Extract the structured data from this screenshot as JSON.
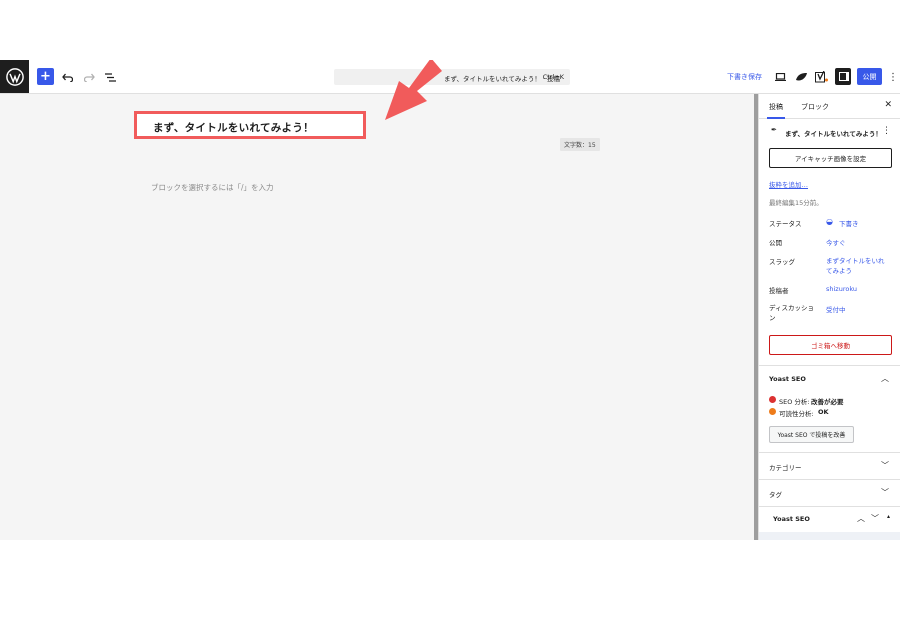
{
  "toolbar": {
    "command_title": "まず、タイトルをいれてみよう！ · 投稿",
    "shortcut": "Ctrl+K",
    "save_draft": "下書き保存",
    "publish": "公開"
  },
  "editor": {
    "post_title": "まず、タイトルをいれてみよう！",
    "char_count": "文字数：15",
    "block_placeholder": "ブロックを選択するには「/」を入力"
  },
  "sidebar": {
    "tabs": [
      "投稿",
      "ブロック"
    ],
    "post_name": "まず、タイトルをいれてみよう！",
    "featured_image_button": "アイキャッチ画像を設定",
    "add_excerpt": "抜粋を追加…",
    "last_edited": "最終編集15分前。",
    "fields": [
      {
        "label": "ステータス",
        "value": "下書き"
      },
      {
        "label": "公開",
        "value": "今すぐ"
      },
      {
        "label": "スラッグ",
        "value": "まずタイトルをいれてみよう"
      },
      {
        "label": "投稿者",
        "value": "shizuroku"
      },
      {
        "label": "ディスカッション",
        "value": "受付中"
      }
    ],
    "trash_button": "ゴミ箱へ移動",
    "yoast_title": "Yoast SEO",
    "seo_label": "SEO 分析:",
    "seo_status": "改善が必要",
    "readability_label": "可読性分析:",
    "readability_status": "OK",
    "yoast_improve_button": "Yoast SEO で投稿を改善",
    "category_panel": "カテゴリー",
    "tag_panel": "タグ",
    "yoast_panel": "Yoast SEO",
    "colors": {
      "seo_bad": "#dc3232",
      "readability_ok": "#ee7c1b",
      "accent": "#3858e9"
    }
  }
}
